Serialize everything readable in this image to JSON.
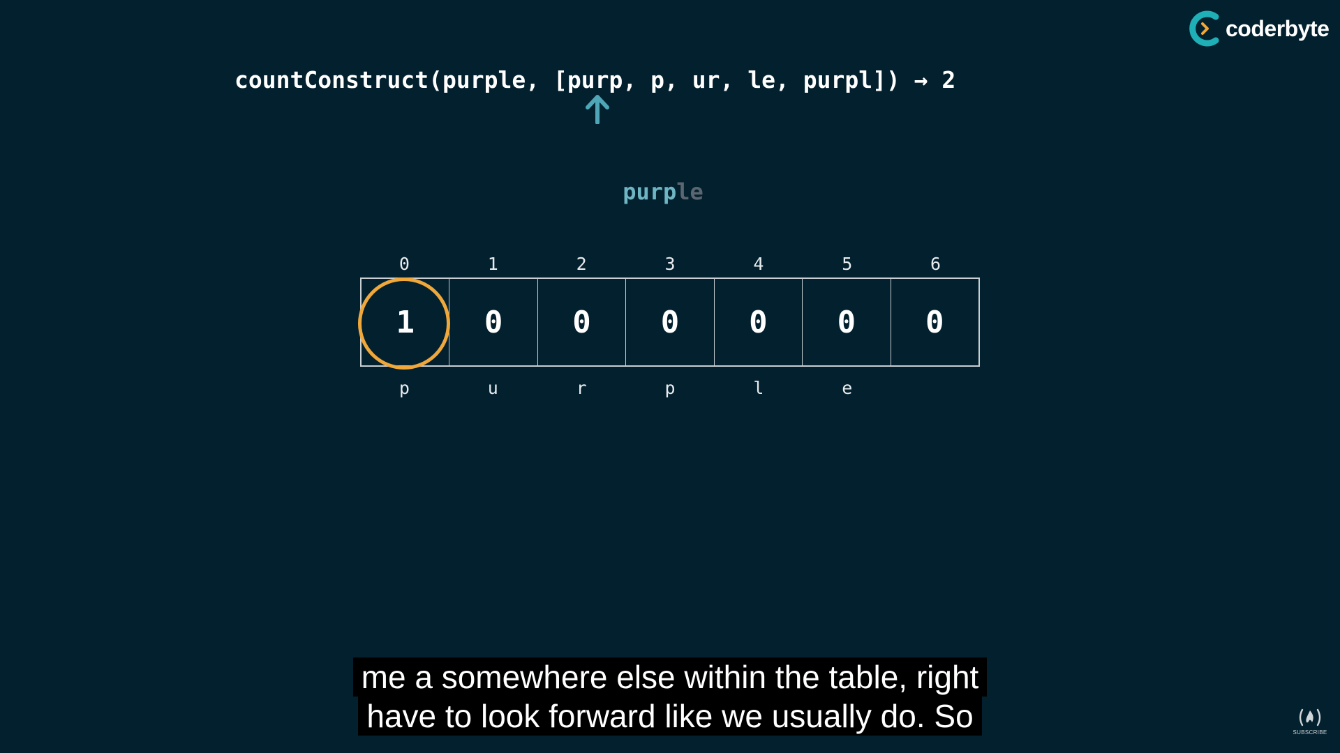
{
  "brand": {
    "name": "coderbyte",
    "logo_icon": "coderbyte-logo-icon",
    "colors": {
      "ring": "#1fb0b7",
      "chevron": "#f0a83a"
    }
  },
  "call": {
    "func": "countConstruct",
    "target": "purple",
    "words": [
      "purp",
      "p",
      "ur",
      "le",
      "purpl"
    ],
    "result": "2",
    "arrow_glyph": "→",
    "pointer_icon": "up-arrow-icon",
    "pointer_color": "#4fa6b6"
  },
  "progress": {
    "matched": "purp",
    "remaining": "le"
  },
  "table": {
    "indices": [
      "0",
      "1",
      "2",
      "3",
      "4",
      "5",
      "6"
    ],
    "values": [
      "1",
      "0",
      "0",
      "0",
      "0",
      "0",
      "0"
    ],
    "chars": [
      "p",
      "u",
      "r",
      "p",
      "l",
      "e",
      ""
    ],
    "highlight_index": 0,
    "highlight_color": "#f0a83a"
  },
  "captions": [
    "me a somewhere else within the table, right",
    "have to look forward like we usually do. So"
  ],
  "subscribe": {
    "label": "SUBSCRIBE",
    "icon": "freecodecamp-flame-icon"
  }
}
